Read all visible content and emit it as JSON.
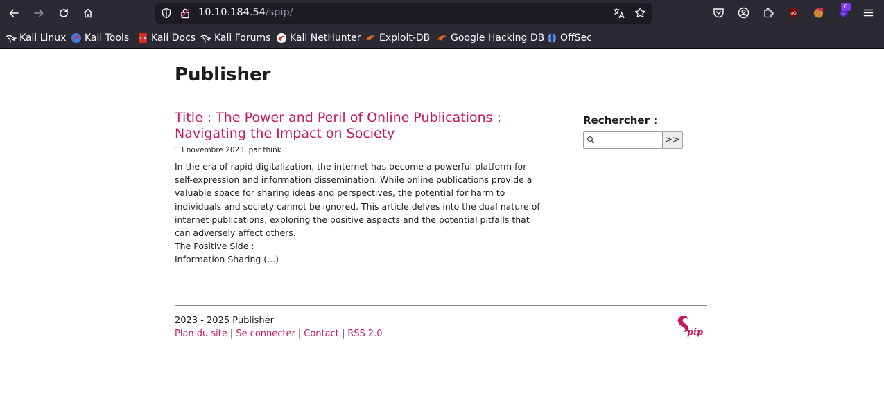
{
  "browser": {
    "url_host": "10.10.184.54",
    "url_path": "/spip/",
    "extension_badge": "6",
    "colors": {
      "chrome_bg": "#2b2a33",
      "urlbar_bg": "#1c1b22",
      "text": "#fbfbfe"
    }
  },
  "bookmarks": [
    {
      "label": "Kali Linux",
      "icon": "kali-dragon-icon"
    },
    {
      "label": "Kali Tools",
      "icon": "kali-tools-icon"
    },
    {
      "label": "Kali Docs",
      "icon": "kali-docs-icon"
    },
    {
      "label": "Kali Forums",
      "icon": "kali-dragon-icon"
    },
    {
      "label": "Kali NetHunter",
      "icon": "nethunter-icon"
    },
    {
      "label": "Exploit-DB",
      "icon": "exploit-db-icon"
    },
    {
      "label": "Google Hacking DB",
      "icon": "exploit-db-icon"
    },
    {
      "label": "OffSec",
      "icon": "offsec-icon"
    }
  ],
  "site": {
    "title": "Publisher",
    "accent_color": "#c8185d"
  },
  "article": {
    "title_line1": "Title : The Power and Peril of Online Publications :",
    "title_line2": "Navigating the Impact on Society",
    "meta": "13 novembre 2023, par think",
    "body": "In the era of rapid digitalization, the internet has become a powerful platform for self-expression and information dissemination. While online publications provide a valuable space for sharing ideas and perspectives, the potential for harm to individuals and society cannot be ignored. This article delves into the dual nature of internet publications, exploring the positive aspects and the potential pitfalls that can adversely affect others.",
    "line_positive": "The Positive Side :",
    "line_info": "Information Sharing (...)"
  },
  "search": {
    "label": "Rechercher :",
    "value": "",
    "button_label": ">>"
  },
  "footer": {
    "copyright": "2023 - 2025 Publisher",
    "links": [
      "Plan du site",
      "Se connecter",
      "Contact",
      "RSS 2.0"
    ],
    "separator": "|",
    "logo_text": "Spip"
  }
}
